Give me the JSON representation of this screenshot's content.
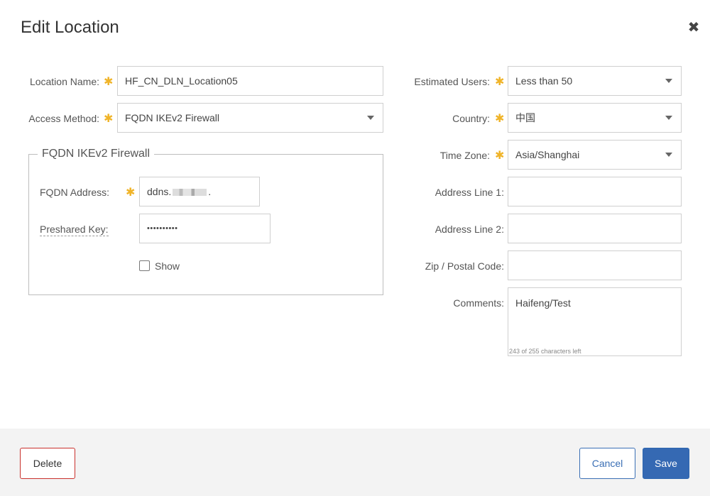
{
  "dialog": {
    "title": "Edit Location",
    "close_glyph": "✖"
  },
  "left": {
    "location_name": {
      "label": "Location Name:",
      "value": "HF_CN_DLN_Location05"
    },
    "access_method": {
      "label": "Access Method:",
      "value": "FQDN IKEv2 Firewall"
    },
    "group": {
      "legend": "FQDN IKEv2 Firewall",
      "fqdn_address": {
        "label": "FQDN Address:",
        "value_prefix": "ddns.",
        "value_suffix": "."
      },
      "preshared_key": {
        "label": "Preshared Key:",
        "value": "••••••••••"
      },
      "show": {
        "label": "Show",
        "checked": false
      }
    }
  },
  "right": {
    "estimated_users": {
      "label": "Estimated Users:",
      "value": "Less than 50"
    },
    "country": {
      "label": "Country:",
      "value": "中国"
    },
    "time_zone": {
      "label": "Time Zone:",
      "value": "Asia/Shanghai"
    },
    "address_line_1": {
      "label": "Address Line 1:",
      "value": ""
    },
    "address_line_2": {
      "label": "Address Line 2:",
      "value": ""
    },
    "zip": {
      "label": "Zip / Postal Code:",
      "value": ""
    },
    "comments": {
      "label": "Comments:",
      "value": "Haifeng/Test",
      "counter": "243 of 255 characters left"
    }
  },
  "required_marker": "✱",
  "footer": {
    "delete_label": "Delete",
    "cancel_label": "Cancel",
    "save_label": "Save"
  },
  "colors": {
    "required": "#f0b429",
    "primary": "#3569b3",
    "danger": "#c9302c"
  },
  "icons": [
    "close-icon",
    "dropdown-caret-icon",
    "required-asterisk-icon"
  ]
}
